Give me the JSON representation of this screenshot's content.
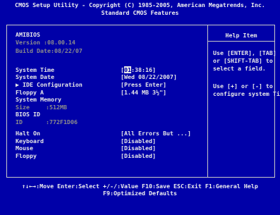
{
  "header": {
    "line1": "CMOS Setup Utility - Copyright (C) 1985-2005, American Megatrends, Inc.",
    "line2": "Standard CMOS Features"
  },
  "bios_info": {
    "title": "AMIBIOS",
    "version": "Version    :08.00.14",
    "build_date": "Build Date:08/22/07"
  },
  "settings": {
    "system_time": {
      "label": "System Time",
      "value_prefix": "[",
      "value_hour": "01",
      "value_rest": ":38:16]"
    },
    "system_date": {
      "label": "System Date",
      "value": "[Wed 08/22/2007]"
    },
    "ide": {
      "label": "▶ IDE Configuration",
      "value": "[Press Enter]"
    },
    "floppy_a": {
      "label": "Floppy A",
      "value": "[1.44 MB 3½\"]"
    },
    "system_memory": {
      "label": "System Memory"
    },
    "size": {
      "label": "Size",
      "value": ":512MB"
    },
    "bios_id": {
      "label": "BIOS ID"
    },
    "id": {
      "label": "ID",
      "value": ":772F1D06"
    },
    "halt_on": {
      "label": "Halt On",
      "value": "[All Errors But ...]"
    },
    "keyboard": {
      "label": "Keyboard",
      "value": "[Disabled]"
    },
    "mouse": {
      "label": "Mouse",
      "value": "[Disabled]"
    },
    "floppy": {
      "label": "Floppy",
      "value": "[Disabled]"
    }
  },
  "help": {
    "title": "Help Item",
    "lines": [
      "Use [ENTER], [TAB]",
      "or [SHIFT-TAB] to",
      "select a field.",
      "",
      "Use [+] or [-] to",
      "configure system Time."
    ]
  },
  "footer": {
    "line1": "↑↓←→:Move  Enter:Select  +/-/:Value  F10:Save  ESC:Exit  F1:General Help",
    "line2": "F9:Optimized Defaults"
  },
  "colors": {
    "background": "#0000a8",
    "text": "#b8b8b8",
    "highlight": "#e8e8e8"
  }
}
